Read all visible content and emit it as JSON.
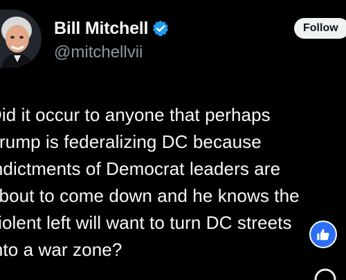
{
  "author": {
    "display_name": "Bill Mitchell",
    "handle": "@mitchellvii",
    "verified": true,
    "verified_color": "#1d9bf0"
  },
  "actions": {
    "follow_label": "Follow"
  },
  "tweet": {
    "text": "Did it occur to anyone that perhaps\nTrump is federalizing DC because\nindictments of Democrat leaders are\nabout to come down and he knows the\nviolent left will want to turn DC streets\ninto a war zone?"
  },
  "overlay": {
    "like_icon": "thumbs-up-icon",
    "like_color": "#2a6ff6",
    "bottom_icon": "circle-icon"
  }
}
